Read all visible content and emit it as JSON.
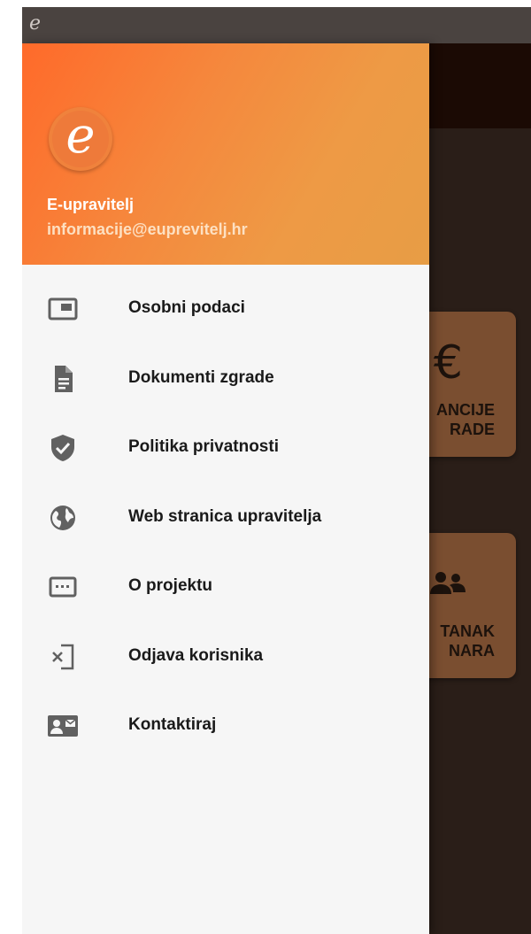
{
  "status_bar": {
    "app_glyph": "e"
  },
  "drawer": {
    "header": {
      "avatar_letter": "e",
      "name": "E-upravitelj",
      "email": "informacije@euprevitelj.hr"
    },
    "items": [
      {
        "label": "Osobni podaci",
        "icon": "profile-card-icon"
      },
      {
        "label": "Dokumenti zgrade",
        "icon": "document-icon"
      },
      {
        "label": "Politika privatnosti",
        "icon": "shield-check-icon"
      },
      {
        "label": "Web stranica upravitelja",
        "icon": "globe-icon"
      },
      {
        "label": "O projektu",
        "icon": "keyboard-dots-icon"
      },
      {
        "label": "Odjava korisnika",
        "icon": "logout-icon"
      },
      {
        "label": "Kontaktiraj",
        "icon": "contact-card-icon"
      }
    ]
  },
  "background": {
    "tiles": [
      {
        "icon_text": "€",
        "line1": "ANCIJE",
        "line2": "RADE"
      },
      {
        "icon_text": "",
        "line1": "TANAK",
        "line2": "NARA"
      }
    ]
  },
  "colors": {
    "header_gradient_start": "#ff6a2a",
    "header_gradient_end": "#e79d45",
    "drawer_bg": "#f6f6f6",
    "icon_color": "#616161",
    "label_color": "#1a1a1a"
  }
}
